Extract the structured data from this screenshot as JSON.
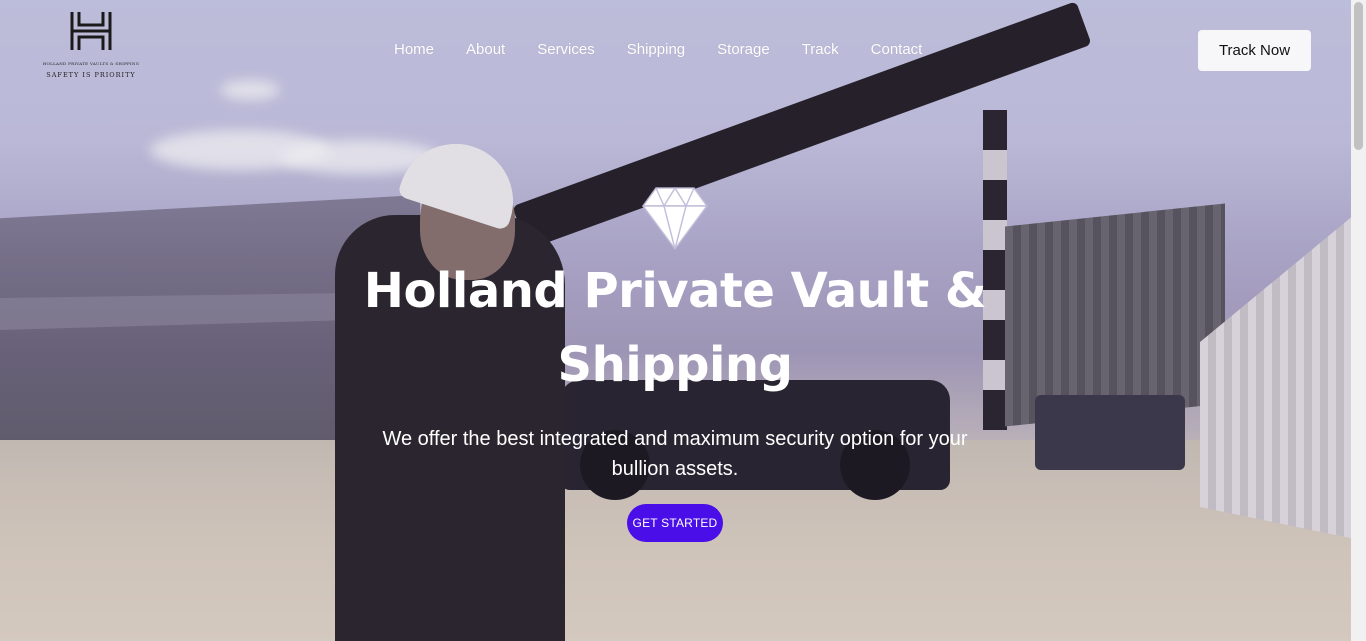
{
  "brand": {
    "logo_small_text": "HOLLAND PRIVATE VAULTS & SHIPPING",
    "tagline": "SAFETY IS PRIORITY"
  },
  "nav": {
    "items": [
      {
        "label": "Home"
      },
      {
        "label": "About"
      },
      {
        "label": "Services"
      },
      {
        "label": "Shipping"
      },
      {
        "label": "Storage"
      },
      {
        "label": "Track"
      },
      {
        "label": "Contact"
      }
    ],
    "cta_label": "Track Now"
  },
  "hero": {
    "icon": "diamond-icon",
    "title": "Holland Private Vault & Shipping",
    "subtitle": "We offer the best integrated and maximum security option for your bullion assets.",
    "button_label": "GET STARTED"
  },
  "colors": {
    "accent": "#4a0ee8",
    "nav_text": "#ffffff",
    "track_button_bg": "#f7f7f9"
  }
}
